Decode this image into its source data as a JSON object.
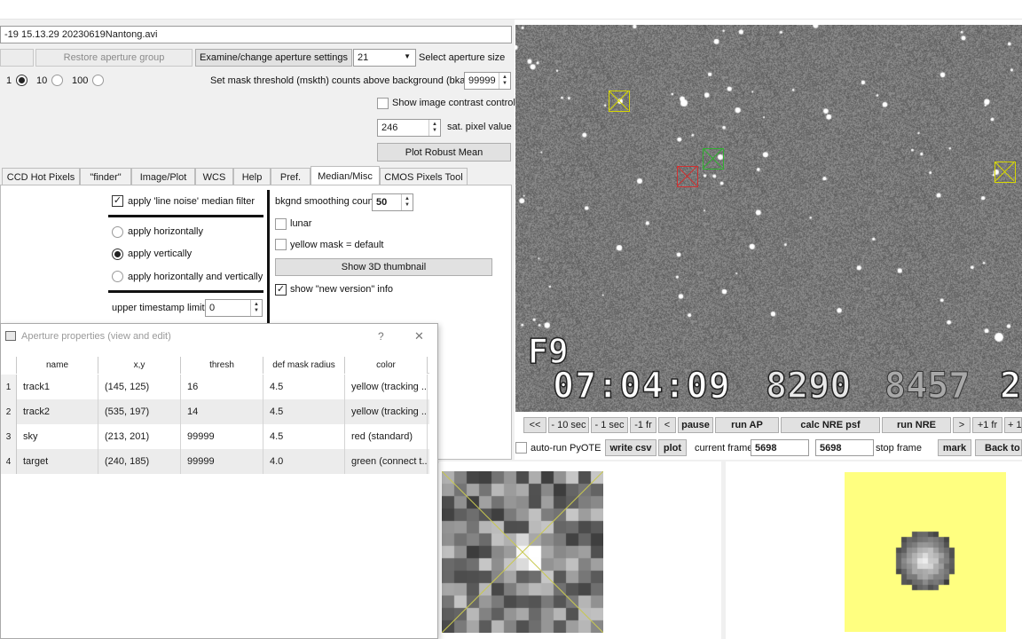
{
  "file_path": "-19 15.13.29 20230619Nantong.avi",
  "top_buttons": {
    "restore_label": "Restore aperture group",
    "examine_label": "Examine/change aperture settings",
    "aperture_size_value": "21",
    "select_aperture_label": "Select aperture size"
  },
  "radio_group": {
    "opt1": "1",
    "opt2": "10",
    "opt3": "100"
  },
  "mask": {
    "label": "Set mask threshold (mskth) counts above background (bkavg)",
    "value": "99999"
  },
  "contrast": {
    "label": "Show image contrast control"
  },
  "sat": {
    "value": "246",
    "label": "sat. pixel value"
  },
  "robust_mean_label": "Plot Robust Mean",
  "tabs": [
    "CCD Hot Pixels",
    "\"finder\"",
    "Image/Plot",
    "WCS",
    "Help",
    "Pref.",
    "Median/Misc",
    "CMOS Pixels Tool"
  ],
  "median": {
    "line_noise": "apply 'line noise' median filter",
    "horiz": "apply horizontally",
    "vert": "apply vertically",
    "both": "apply horizontally and vertically",
    "timestamp_label": "upper timestamp limit",
    "timestamp_value": "0",
    "bkgnd_label": "bkgnd smoothing count",
    "bkgnd_value": "50",
    "lunar": "lunar",
    "yellow_mask": "yellow mask = default",
    "thumbnail_btn": "Show 3D thumbnail",
    "new_version": "show \"new version\" info"
  },
  "dialog": {
    "title": "Aperture properties (view and edit)",
    "help": "?",
    "close": "✕",
    "headers": [
      "name",
      "x,y",
      "thresh",
      "def mask radius",
      "color"
    ],
    "rows": [
      {
        "num": "1",
        "name": "track1",
        "xy": "(145, 125)",
        "thresh": "16",
        "radius": "4.5",
        "color": "yellow (tracking ..."
      },
      {
        "num": "2",
        "name": "track2",
        "xy": "(535, 197)",
        "thresh": "14",
        "radius": "4.5",
        "color": "yellow (tracking ..."
      },
      {
        "num": "3",
        "name": "sky",
        "xy": "(213, 201)",
        "thresh": "99999",
        "radius": "4.5",
        "color": "red (standard)"
      },
      {
        "num": "4",
        "name": "target",
        "xy": "(240, 185)",
        "thresh": "99999",
        "radius": "4.0",
        "color": "green (connect t..."
      }
    ]
  },
  "video": {
    "overlay_field": "F9",
    "timestamp": "07:04:09",
    "frame_a": "8290",
    "frame_b": "8457",
    "frame_c": "2"
  },
  "video_controls": [
    "<<",
    "- 10 sec",
    "- 1 sec",
    "-1 fr",
    "<",
    "pause",
    "run AP",
    "calc NRE psf",
    "run NRE",
    ">",
    "+1 fr",
    "+ 1"
  ],
  "bottom_bar": {
    "autorun": "auto-run PyOTE",
    "write_csv": "write csv",
    "plot": "plot",
    "current_frame_label": "current frame",
    "current_frame_value": "5698",
    "stop_frame_value": "5698",
    "stop_frame_label": "stop frame",
    "mark": "mark",
    "back_to": "Back to"
  },
  "colors": {
    "yellow_aperture": "#d8d800",
    "red_aperture": "#d03030",
    "green_aperture": "#30b030",
    "thumb_background": "#ffff80"
  }
}
